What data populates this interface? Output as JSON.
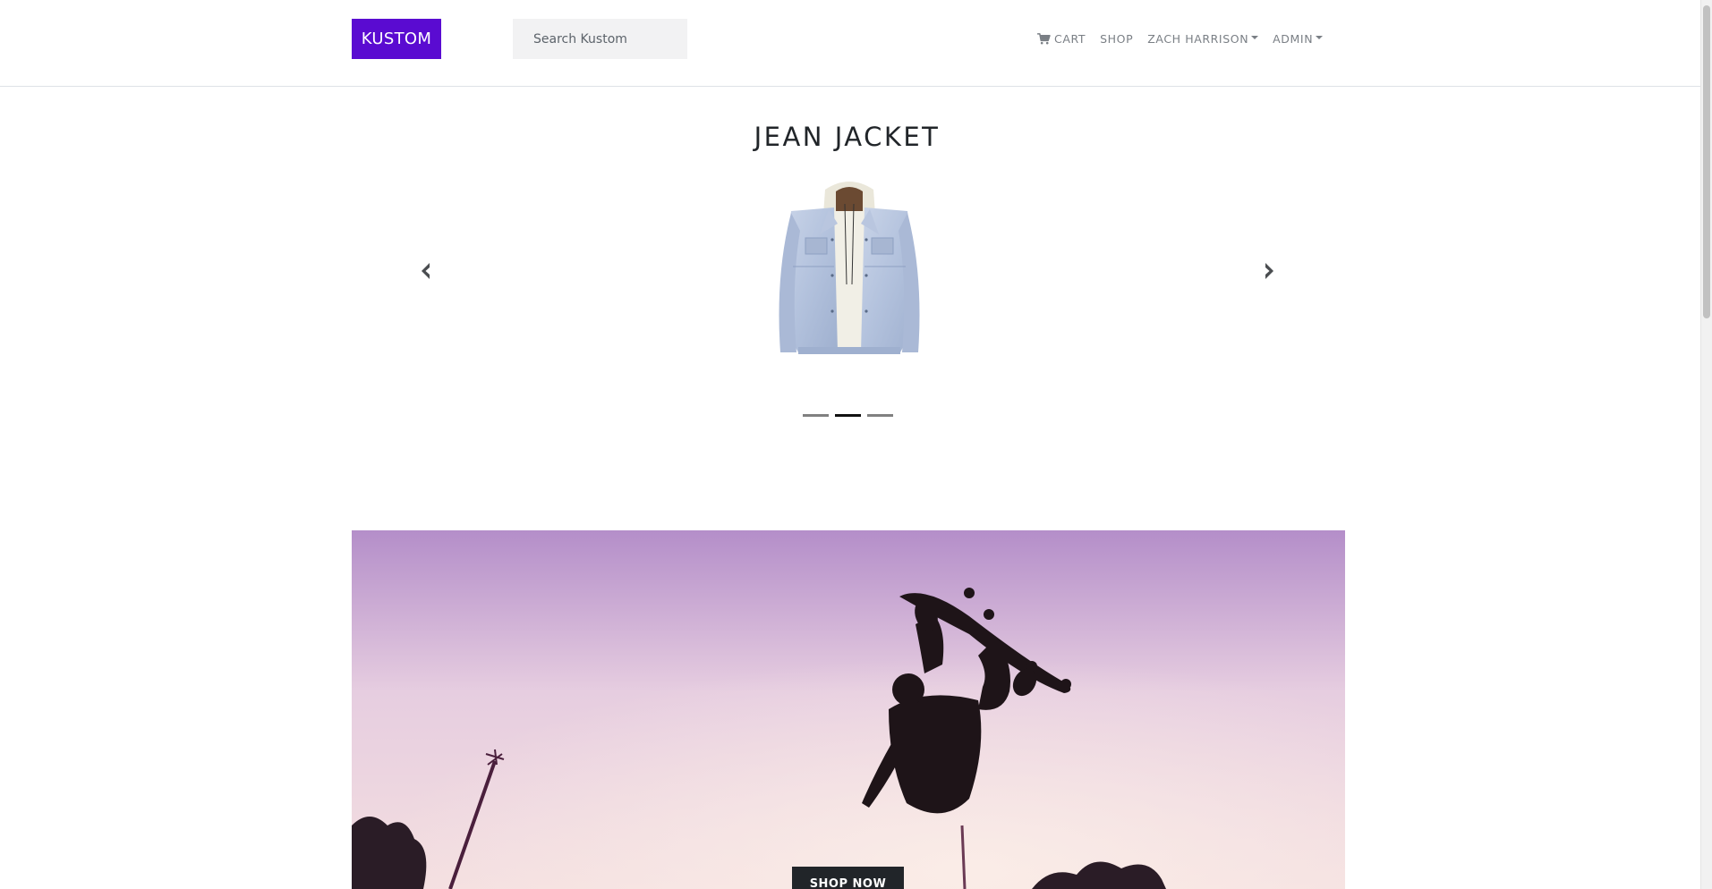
{
  "navbar": {
    "brand": "KUSTOM",
    "search_placeholder": "Search Kustom",
    "search_value": "",
    "links": {
      "cart": "CART",
      "shop": "SHOP",
      "user": "ZACH HARRISON",
      "admin": "ADMIN"
    },
    "cart_icon": "shopping-cart-icon"
  },
  "carousel": {
    "title": "JEAN JACKET",
    "prev_icon": "chevron-left-icon",
    "next_icon": "chevron-right-icon",
    "slide_count": 3,
    "active_slide": 2
  },
  "hero": {
    "button_label": "SHOP NOW"
  },
  "colors": {
    "brand": "#5a0bd1",
    "nav_text": "#7a7f85",
    "title_text": "#212529",
    "button_bg": "#212529"
  }
}
